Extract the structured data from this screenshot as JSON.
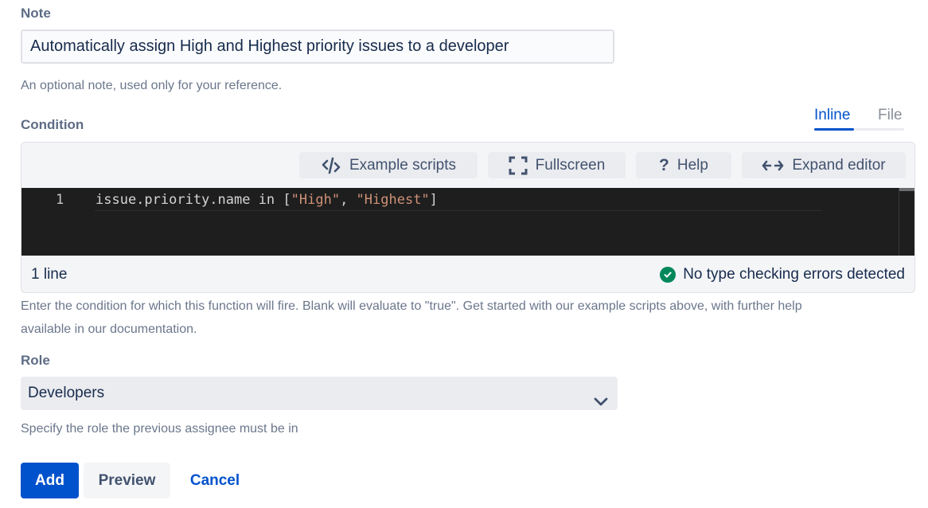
{
  "note": {
    "label": "Note",
    "value": "Automatically assign High and Highest priority issues to a developer",
    "help": "An optional note, used only for your reference."
  },
  "condition": {
    "label": "Condition",
    "tabs": [
      {
        "label": "Inline",
        "active": true
      },
      {
        "label": "File",
        "active": false
      }
    ],
    "toolbar": {
      "example_scripts": {
        "label": "Example scripts",
        "icon": "code-icon"
      },
      "fullscreen": {
        "label": "Fullscreen",
        "icon": "fullscreen-icon"
      },
      "help": {
        "label": "Help",
        "icon": "question-icon"
      },
      "expand_editor": {
        "label": "Expand editor",
        "icon": "expand-arrows-icon"
      }
    },
    "code": {
      "line_number": "1",
      "tokens": {
        "plain": "issue.priority.name in [",
        "str1": "\"High\"",
        "sep": ", ",
        "str2": "\"Highest\"",
        "end": "]"
      }
    },
    "status": {
      "line_count": "1 line",
      "type_check": "No type checking errors detected",
      "type_check_status": "success"
    },
    "help_line1": "Enter the condition for which this function will fire. Blank will evaluate to \"true\". Get started with our example scripts above, with further help",
    "help_line2": "available in our documentation."
  },
  "role": {
    "label": "Role",
    "selected": "Developers",
    "help": "Specify the role the previous assignee must be in"
  },
  "actions": {
    "add": "Add",
    "preview": "Preview",
    "cancel": "Cancel"
  },
  "colors": {
    "primary": "#0052cc",
    "success": "#00875a",
    "editor_bg": "#1e1e1e",
    "string": "#ce9178"
  }
}
